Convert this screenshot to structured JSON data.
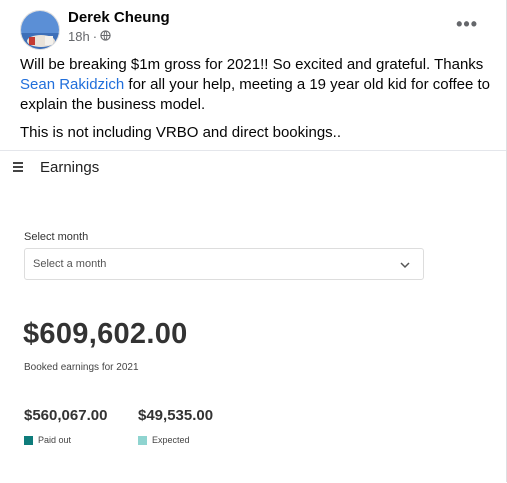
{
  "post": {
    "author": "Derek Cheung",
    "time": "18h",
    "privacy_icon": "globe-icon",
    "more_icon": "more-options-icon",
    "more_label": "•••",
    "text_before_link": "Will be breaking $1m gross for 2021!! So excited and grateful. Thanks ",
    "link_text": "Sean Rakidzich",
    "text_after_link": " for all your help, meeting a 19 year old kid for coffee to explain the business model.",
    "text_second": "This is not including VRBO and direct bookings.."
  },
  "earnings": {
    "menu_icon": "hamburger-menu-icon",
    "title": "Earnings",
    "select_label": "Select month",
    "select_placeholder": "Select a month",
    "select_icon": "chevron-down-icon",
    "total": "$609,602.00",
    "total_caption": "Booked earnings for 2021",
    "paid_amount": "$560,067.00",
    "paid_label": "Paid out",
    "paid_color": "#0e7c7b",
    "expected_amount": "$49,535.00",
    "expected_label": "Expected",
    "expected_color": "#8fd4d0"
  }
}
